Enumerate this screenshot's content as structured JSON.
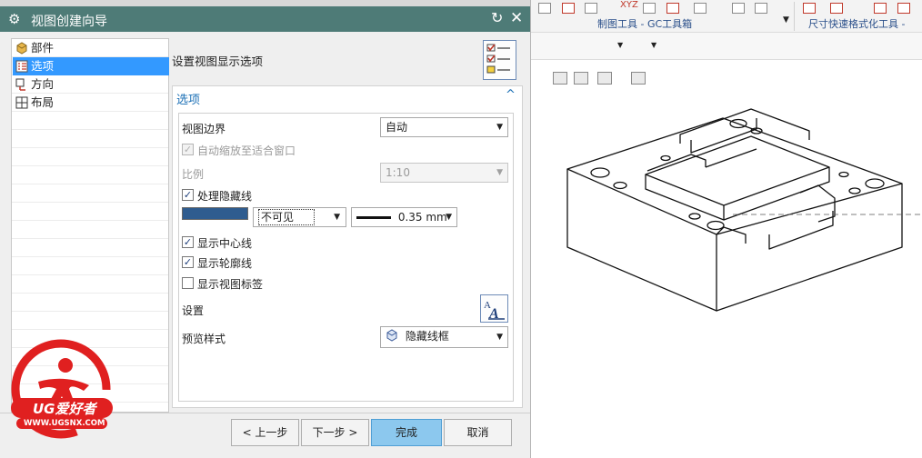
{
  "background_app": {
    "ribbon_group_1": "制图工具 - GC工具箱",
    "ribbon_group_2": "尺寸快速格式化工具 - GC",
    "ribbon_top_text": "XYZ"
  },
  "dialog": {
    "title": "视图创建向导",
    "nav": [
      "部件",
      "选项",
      "方向",
      "布局"
    ],
    "header_title": "设置视图显示选项",
    "section_title": "选项",
    "fields": {
      "view_boundary_label": "视图边界",
      "view_boundary_value": "自动",
      "auto_scale_label": "自动缩放至适合窗口",
      "scale_label": "比例",
      "scale_value": "1:10",
      "hidden_lines_label": "处理隐藏线",
      "hidden_line_style_value": "不可见",
      "hidden_line_width_value": "0.35 mm",
      "center_lines_label": "显示中心线",
      "silhouettes_label": "显示轮廓线",
      "view_label_label": "显示视图标签",
      "settings_label": "设置",
      "preview_style_label": "预览样式",
      "preview_style_value": "隐藏线框"
    },
    "checkbox_state": {
      "auto_scale": true,
      "hidden_lines": true,
      "center_lines": true,
      "silhouettes": true,
      "view_label": false
    },
    "buttons": {
      "back": "< 上一步",
      "next": "下一步 >",
      "finish": "完成",
      "cancel": "取消"
    },
    "colors": {
      "titlebar": "#4e7b77",
      "nav_selected": "#3399ff",
      "hidden_line_color": "#2f5c8f",
      "finish_button": "#8cc8ee"
    }
  },
  "watermark": {
    "brand": "UG爱好者",
    "url": "WWW.UGSNX.COM"
  }
}
